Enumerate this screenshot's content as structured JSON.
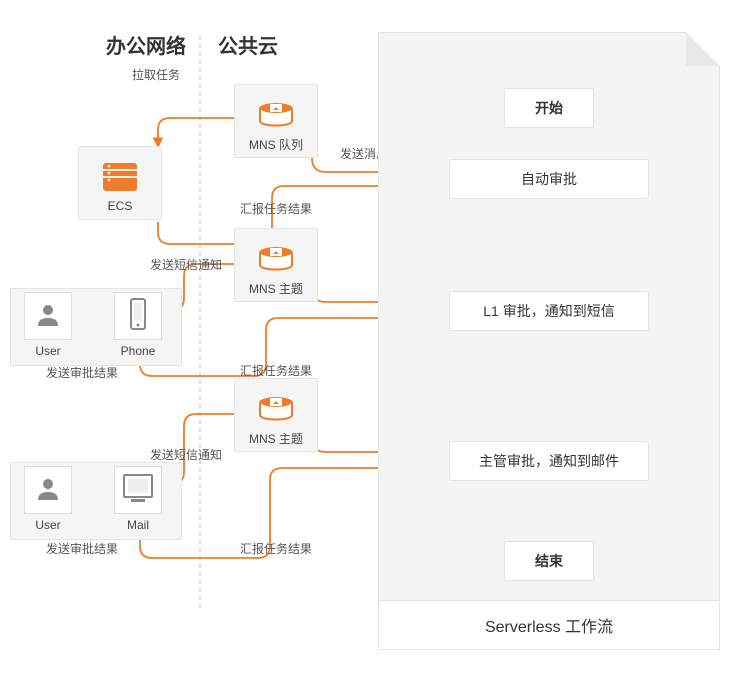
{
  "sections": {
    "office": "办公网络",
    "cloud": "公共云"
  },
  "labels": {
    "pull_task": "拉取任务",
    "send_msg": "发送消息",
    "report_result_1": "汇报任务结果",
    "send_sms_notify_1": "发送短信通知",
    "report_result_2": "汇报任务结果",
    "send_approval_result_1": "发送审批结果",
    "send_sms_notify_2": "发送短信通知",
    "report_result_3": "汇报任务结果",
    "send_approval_result_2": "发送审批结果"
  },
  "icons": {
    "ecs": {
      "caption": "ECS"
    },
    "mns_queue": {
      "caption": "MNS 队列"
    },
    "mns_topic_1": {
      "caption": "MNS 主题"
    },
    "mns_topic_2": {
      "caption": "MNS 主题"
    },
    "user_1": {
      "caption": "User"
    },
    "phone": {
      "caption": "Phone"
    },
    "user_2": {
      "caption": "User"
    },
    "mail": {
      "caption": "Mail"
    }
  },
  "flow": {
    "title": "Serverless 工作流",
    "steps": {
      "start": "开始",
      "auto_approval": "自动审批",
      "l1_approval": "L1 审批，通知到短信",
      "manager_approval": "主管审批，通知到邮件",
      "end": "结束"
    }
  },
  "chart_data": {
    "type": "diagram",
    "title": "Serverless 工作流",
    "sections": [
      "办公网络",
      "公共云"
    ],
    "nodes": [
      {
        "id": "start",
        "label": "开始",
        "kind": "flow-step"
      },
      {
        "id": "auto",
        "label": "自动审批",
        "kind": "flow-step"
      },
      {
        "id": "l1",
        "label": "L1 审批，通知到短信",
        "kind": "flow-step"
      },
      {
        "id": "mgr",
        "label": "主管审批，通知到邮件",
        "kind": "flow-step"
      },
      {
        "id": "end",
        "label": "结束",
        "kind": "flow-step"
      },
      {
        "id": "ecs",
        "label": "ECS",
        "kind": "service",
        "section": "办公网络"
      },
      {
        "id": "mnsq",
        "label": "MNS 队列",
        "kind": "service",
        "section": "公共云"
      },
      {
        "id": "mnst1",
        "label": "MNS 主题",
        "kind": "service",
        "section": "公共云"
      },
      {
        "id": "mnst2",
        "label": "MNS 主题",
        "kind": "service",
        "section": "公共云"
      },
      {
        "id": "user1",
        "label": "User",
        "kind": "actor",
        "section": "办公网络"
      },
      {
        "id": "phone",
        "label": "Phone",
        "kind": "device",
        "section": "办公网络"
      },
      {
        "id": "user2",
        "label": "User",
        "kind": "actor",
        "section": "办公网络"
      },
      {
        "id": "mail",
        "label": "Mail",
        "kind": "device",
        "section": "办公网络"
      }
    ],
    "edges": [
      {
        "from": "start",
        "to": "auto",
        "label": ""
      },
      {
        "from": "auto",
        "to": "l1",
        "label": ""
      },
      {
        "from": "l1",
        "to": "mgr",
        "label": ""
      },
      {
        "from": "mgr",
        "to": "end",
        "label": ""
      },
      {
        "from": "auto",
        "to": "mnsq",
        "label": "发送消息"
      },
      {
        "from": "mnsq",
        "to": "ecs",
        "label": "拉取任务"
      },
      {
        "from": "ecs",
        "to": "auto",
        "label": "汇报任务结果"
      },
      {
        "from": "l1",
        "to": "mnst1",
        "label": ""
      },
      {
        "from": "mnst1",
        "to": "phone",
        "label": "发送短信通知"
      },
      {
        "from": "phone",
        "to": "user1",
        "label": ""
      },
      {
        "from": "user1",
        "to": "phone",
        "label": "发送审批结果"
      },
      {
        "from": "phone",
        "to": "l1",
        "label": "汇报任务结果"
      },
      {
        "from": "mgr",
        "to": "mnst2",
        "label": ""
      },
      {
        "from": "mnst2",
        "to": "mail",
        "label": "发送短信通知"
      },
      {
        "from": "mail",
        "to": "user2",
        "label": ""
      },
      {
        "from": "user2",
        "to": "mail",
        "label": "发送审批结果"
      },
      {
        "from": "mail",
        "to": "mgr",
        "label": "汇报任务结果"
      }
    ]
  }
}
